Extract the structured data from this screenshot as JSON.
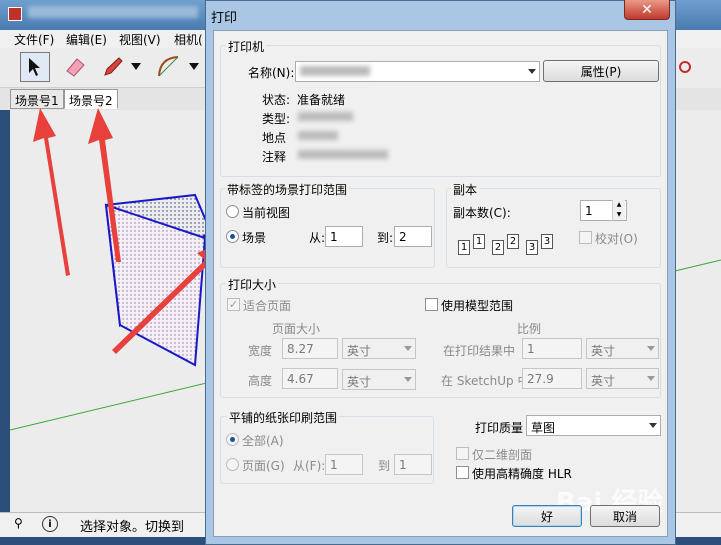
{
  "app": {
    "menus": [
      "文件(F)",
      "编辑(E)",
      "视图(V)",
      "相机("
    ],
    "scene_tabs": [
      "场景号1",
      "场景号2"
    ],
    "status_text": "选择对象。切换到"
  },
  "dialog": {
    "title": "打印",
    "close_label": "✕",
    "printer": {
      "group_title": "打印机",
      "name_label": "名称(N):",
      "properties_button": "属性(P)",
      "status_label": "状态:",
      "status_value": "准备就绪",
      "type_label": "类型:",
      "where_label": "地点",
      "comment_label": "注释"
    },
    "scene_range": {
      "group_title": "带标签的场景打印范围",
      "current_view": "当前视图",
      "scenes": "场景",
      "from_label": "从:",
      "from_value": "1",
      "to_label": "到:",
      "to_value": "2"
    },
    "copies": {
      "group_title": "副本",
      "count_label": "副本数(C):",
      "count_value": "1",
      "collate_label": "校对(O)",
      "page_icons": [
        "1",
        "1",
        "2",
        "2",
        "3",
        "3"
      ]
    },
    "print_size": {
      "group_title": "打印大小",
      "fit_page": "适合页面",
      "use_model_extents": "使用模型范围",
      "page_size_label": "页面大小",
      "scale_label": "比例",
      "width_label": "宽度",
      "width_value": "8.27",
      "width_unit": "英寸",
      "height_label": "高度",
      "height_value": "4.67",
      "height_unit": "英寸",
      "in_printout_label": "在打印结果中",
      "in_printout_value": "1",
      "in_printout_unit": "英寸",
      "in_sketchup_label": "在 SketchUp 中",
      "in_sketchup_value": "27.9",
      "in_sketchup_unit": "英寸"
    },
    "tiled_range": {
      "group_title": "平铺的纸张印刷范围",
      "all": "全部(A)",
      "pages": "页面(G)",
      "from_label": "从(F):",
      "from_value": "1",
      "to_label": "到",
      "to_value": "1"
    },
    "quality": {
      "label": "打印质量",
      "value": "草图",
      "two_d_section": "仅二维剖面",
      "high_accuracy_hlr": "使用高精确度 HLR"
    },
    "ok_button": "好",
    "cancel_button": "取消"
  },
  "watermark": "Bai 经验",
  "colors": {
    "dialog_frame": "#aac6e5",
    "arrow": "#e8403a",
    "box_edge": "#1818c8",
    "axis_green": "#3aa83a"
  }
}
